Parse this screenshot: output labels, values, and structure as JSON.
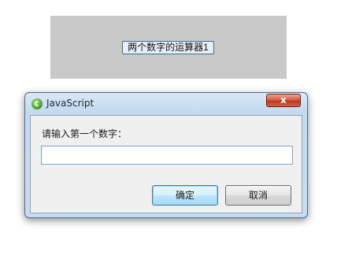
{
  "page": {
    "button_label": "两个数字的运算器1"
  },
  "dialog": {
    "title": "JavaScript",
    "close_symbol": "x",
    "prompt": "请输入第一个数字：",
    "input_value": "",
    "ok_label": "确定",
    "cancel_label": "取消"
  }
}
